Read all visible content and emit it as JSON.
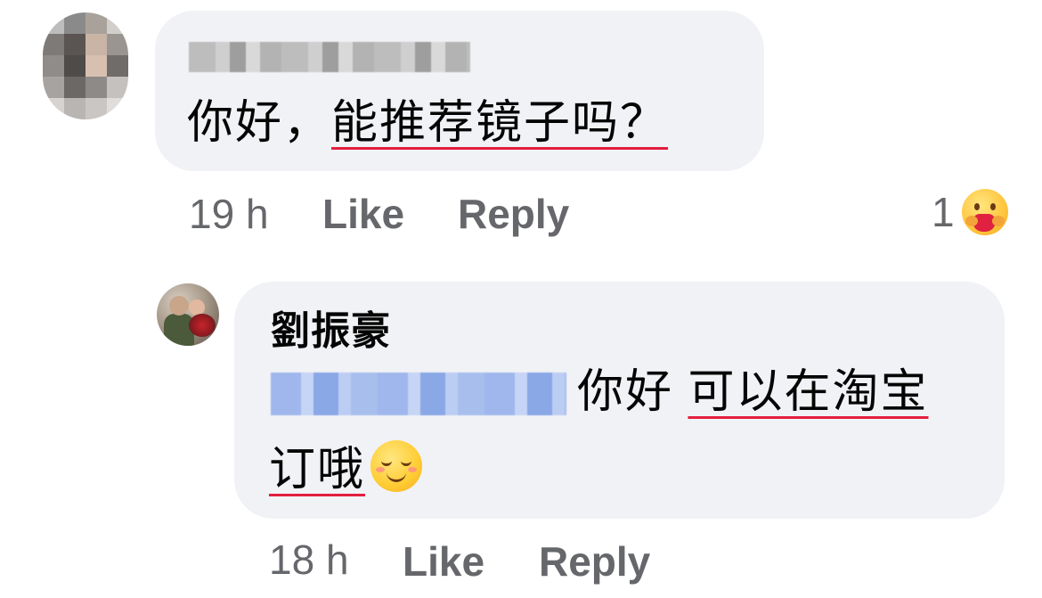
{
  "comment_1": {
    "author_blurred": "",
    "message_plain": "你好，",
    "message_underlined": "能推荐镜子吗？",
    "time": "19 h",
    "like_label": "Like",
    "reply_label": "Reply",
    "reaction_count": "1",
    "reaction_icon": "care-emoji"
  },
  "comment_2": {
    "author": "劉振豪",
    "mention_blurred": "",
    "message_line1_plain": "你好 ",
    "message_line1_underlined": "可以在淘宝",
    "message_line2_underlined": "订哦",
    "emoji": "smiling-face-icon",
    "time": "18 h",
    "like_label": "Like",
    "reply_label": "Reply"
  },
  "colors": {
    "bubble_bg": "#f0f2f5",
    "meta_text": "#65676b",
    "mention_highlight": "#a8beed",
    "underline_red": "#e41e3f"
  }
}
